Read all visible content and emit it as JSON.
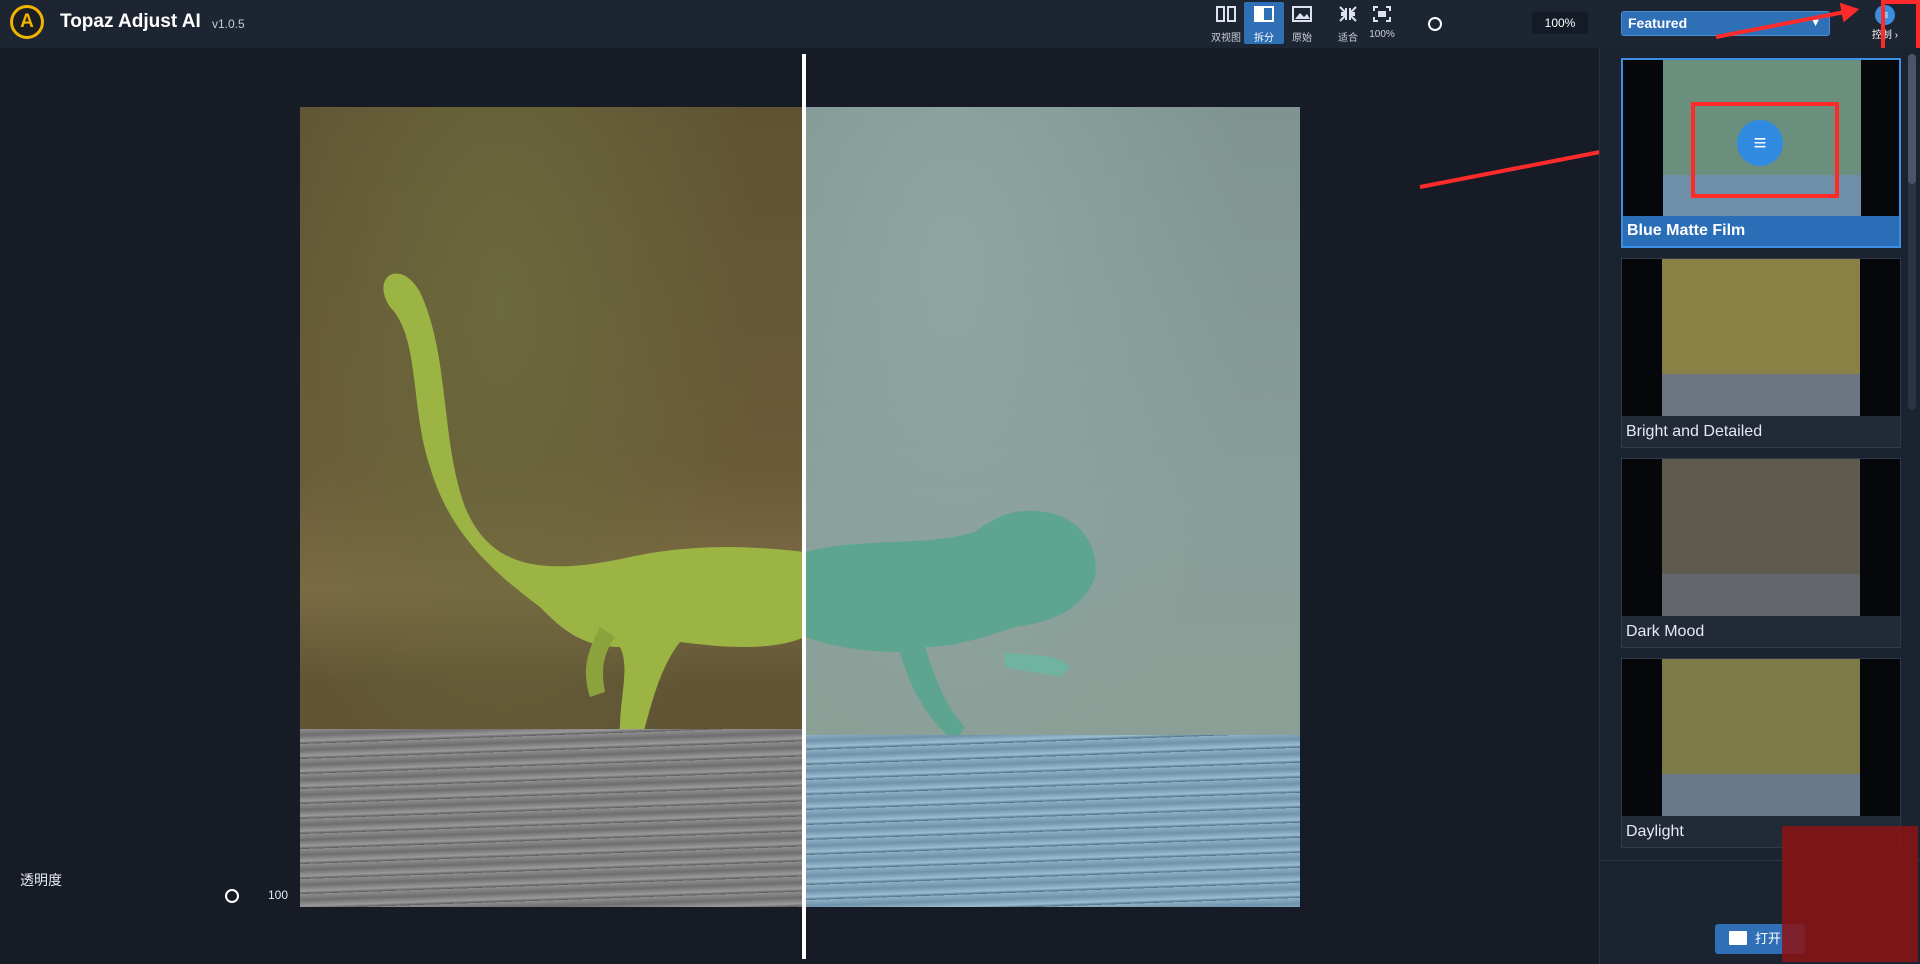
{
  "app": {
    "title": "Topaz Adjust AI",
    "version": "v1.0.5",
    "logo_letter": "A"
  },
  "toolbar": {
    "dual_view": "双视图",
    "split": "拆分",
    "original": "原始",
    "fit": "适合",
    "actual_size": "100%",
    "zoom": "100%"
  },
  "presets": {
    "category": "Featured",
    "control_label": "控制 ›",
    "items": [
      {
        "name": "Blue Matte Film",
        "selected": true,
        "colors": {
          "bg": "#6b8f7d",
          "floor": "#6f8fa8"
        }
      },
      {
        "name": "Bright and Detailed",
        "selected": false,
        "colors": {
          "bg": "#8a7f45",
          "floor": "#6d7583"
        }
      },
      {
        "name": "Dark Mood",
        "selected": false,
        "colors": {
          "bg": "#5f5a4e",
          "floor": "#63666b"
        }
      },
      {
        "name": "Daylight",
        "selected": false,
        "colors": {
          "bg": "#7e7a48",
          "floor": "#69788a"
        }
      }
    ]
  },
  "bottom": {
    "opacity_label": "透明度",
    "opacity_value": "100",
    "open_button": "打开"
  },
  "colors": {
    "accent": "#2f6fb5",
    "highlight": "#ff2b2b",
    "brand": "#f0b400"
  }
}
